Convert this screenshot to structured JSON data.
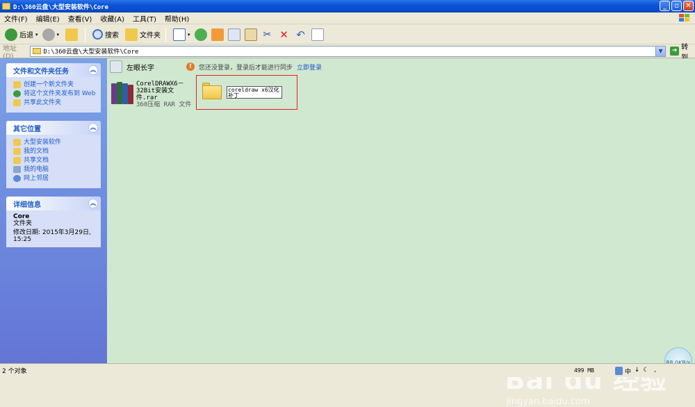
{
  "window": {
    "title": "D:\\360云盘\\大型安装软件\\Core"
  },
  "menubar": {
    "items": [
      "文件(F)",
      "编辑(E)",
      "查看(V)",
      "收藏(A)",
      "工具(T)",
      "帮助(H)"
    ]
  },
  "toolbar": {
    "back_label": "后退",
    "search_label": "搜索",
    "folders_label": "文件夹"
  },
  "address": {
    "label": "地址(D)",
    "path": "D:\\360云盘\\大型安装软件\\Core",
    "go_label": "转到"
  },
  "tasks": {
    "title": "文件和文件夹任务",
    "items": [
      "创建一个新文件夹",
      "将这个文件夹发布到 Web",
      "共享此文件夹"
    ]
  },
  "other_places": {
    "title": "其它位置",
    "items": [
      "大型安装软件",
      "我的文档",
      "共享文档",
      "我的电脑",
      "网上邻居"
    ]
  },
  "details": {
    "title": "详细信息",
    "name": "Core",
    "type": "文件夹",
    "modified": "修改日期: 2015年3月29日, 15:25"
  },
  "content": {
    "side_button": "左眼长字",
    "notice": "您还没登录，登录后才能进行同步",
    "login_link": "立即登录",
    "file1": {
      "name": "CorelDRAWX6－32Bit安装文件.rar",
      "type": "360压缩 RAR 文件"
    },
    "rename_value": "coreldraw x6汉化补丁"
  },
  "status": {
    "count": "2 个对象",
    "memory": "499 MB",
    "speed": "88.0KB/s"
  },
  "watermark": {
    "brand": "Bai du 经验",
    "url": "jingyan.baidu.com"
  }
}
